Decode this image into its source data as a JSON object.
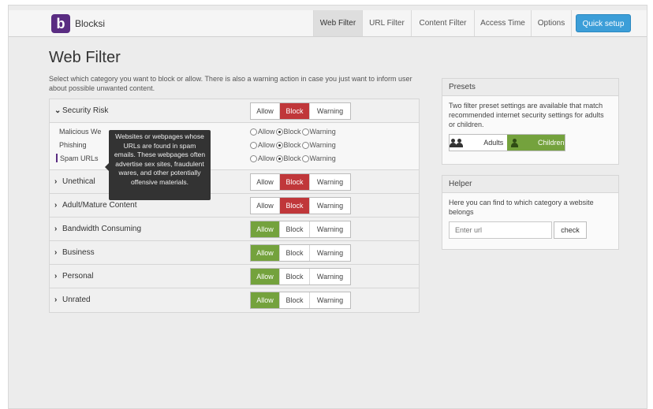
{
  "app": {
    "brand": "Blocksi",
    "logo_letter": "b"
  },
  "nav": {
    "tabs": [
      {
        "label": "Web Filter",
        "active": true
      },
      {
        "label": "URL Filter",
        "active": false
      },
      {
        "label": "Content Filter",
        "active": false
      },
      {
        "label": "Access Time",
        "active": false
      },
      {
        "label": "Options",
        "active": false
      }
    ],
    "quick_setup": "Quick setup"
  },
  "main": {
    "title": "Web Filter",
    "intro": "Select which category you want to block or allow. There is also a warning action in case you just want to inform user about possible unwanted content.",
    "actions": {
      "allow": "Allow",
      "block": "Block",
      "warning": "Warning"
    },
    "categories": [
      {
        "name": "Security Risk",
        "expanded": true,
        "selected": "block",
        "subcategories": [
          {
            "label": "Malicious We",
            "selected": "block"
          },
          {
            "label": "Phishing",
            "selected": "block"
          },
          {
            "label": "Spam URLs",
            "selected": "block"
          }
        ]
      },
      {
        "name": "Unethical",
        "expanded": false,
        "selected": "block"
      },
      {
        "name": "Adult/Mature Content",
        "expanded": false,
        "selected": "block"
      },
      {
        "name": "Bandwidth Consuming",
        "expanded": false,
        "selected": "allow"
      },
      {
        "name": "Business",
        "expanded": false,
        "selected": "allow"
      },
      {
        "name": "Personal",
        "expanded": false,
        "selected": "allow"
      },
      {
        "name": "Unrated",
        "expanded": false,
        "selected": "allow"
      }
    ],
    "tooltip": "Websites or webpages whose URLs are found in spam emails. These webpages often advertise sex sites, fraudulent wares, and other potentially offensive materials."
  },
  "presets": {
    "title": "Presets",
    "description": "Two filter preset settings are available that match recommended internet security settings for adults or children.",
    "adults": "Adults",
    "children": "Children",
    "selected": "children"
  },
  "helper": {
    "title": "Helper",
    "description": "Here you can find to which category a website belongs",
    "placeholder": "Enter url",
    "check": "check"
  },
  "colors": {
    "allow_active": "#74a23d",
    "block_active": "#c0373a",
    "brand": "#5a2d82",
    "quick_setup": "#3c9ed8"
  }
}
